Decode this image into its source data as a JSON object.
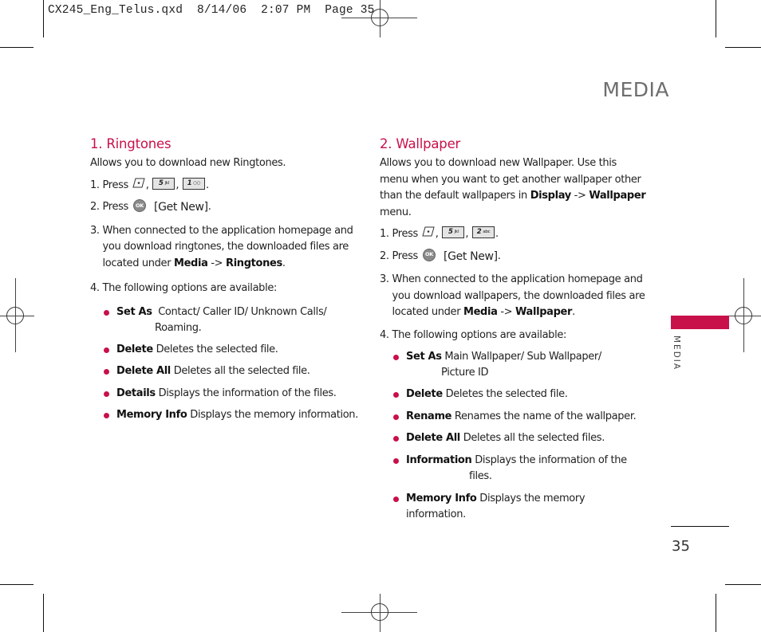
{
  "slug": {
    "file": "CX245_Eng_Telus.qxd",
    "date": "8/14/06",
    "time": "2:07 PM",
    "page_label": "Page 35"
  },
  "header": {
    "title": "MEDIA"
  },
  "side_tab": {
    "label": "MEDIA",
    "color": "#c8104a"
  },
  "page_number": "35",
  "icons": {
    "menu_key": "menu-soft-key-icon",
    "key_5": {
      "digit": "5",
      "letters": "jkl"
    },
    "key_1": {
      "digit": "1",
      "letters": "voicemail"
    },
    "key_2": {
      "digit": "2",
      "letters": "abc"
    },
    "ok_key": {
      "label": "OK"
    }
  },
  "ringtones": {
    "title": "1. Ringtones",
    "intro": "Allows you to download new Ringtones.",
    "step1": {
      "num": "1.",
      "text": "Press",
      "sep": ",",
      "end": "."
    },
    "step2": {
      "num": "2.",
      "text": "Press",
      "action": "[Get New]",
      "end": "."
    },
    "step3": {
      "num": "3.",
      "text": "When connected to the application homepage and you download ringtones, the downloaded files are located under",
      "path_a": "Media",
      "arrow": "->",
      "path_b": "Ringtones",
      "end": "."
    },
    "step4": {
      "num": "4.",
      "text": "The following options are available:"
    },
    "options": [
      {
        "name": "Set As",
        "desc": "Contact/ Caller ID/ Unknown Calls/",
        "desc2": "Roaming."
      },
      {
        "name": "Delete",
        "desc": "Deletes the selected file."
      },
      {
        "name": "Delete All",
        "desc": "Deletes all the selected file."
      },
      {
        "name": "Details",
        "desc": "Displays the information of the files."
      },
      {
        "name": "Memory Info",
        "desc": "Displays the memory information."
      }
    ]
  },
  "wallpaper": {
    "title": "2. Wallpaper",
    "intro": "Allows you to download new Wallpaper. Use this menu when you want to get another wallpaper other than the default wallpapers in",
    "intro_path_a": "Display",
    "intro_arrow": "->",
    "intro_path_b": "Wallpaper",
    "intro_end": "menu.",
    "step1": {
      "num": "1.",
      "text": "Press",
      "sep": ",",
      "end": "."
    },
    "step2": {
      "num": "2.",
      "text": "Press",
      "action": "[Get New]",
      "end": "."
    },
    "step3": {
      "num": "3.",
      "text": "When connected to the application homepage and you download wallpapers, the downloaded files are located under",
      "path_a": "Media",
      "arrow": "->",
      "path_b": "Wallpaper",
      "end": "."
    },
    "step4": {
      "num": "4.",
      "text": "The following options are available:"
    },
    "options": [
      {
        "name": "Set As",
        "desc": "Main Wallpaper/ Sub Wallpaper/",
        "desc2": "Picture ID"
      },
      {
        "name": "Delete",
        "desc": "Deletes the selected file."
      },
      {
        "name": "Rename",
        "desc": "Renames the name of the wallpaper."
      },
      {
        "name": "Delete All",
        "desc": "Deletes all the selected files."
      },
      {
        "name": "Information",
        "desc": "Displays the information of the",
        "desc2": "files."
      },
      {
        "name": "Memory Info",
        "desc": "Displays the memory information."
      }
    ]
  }
}
